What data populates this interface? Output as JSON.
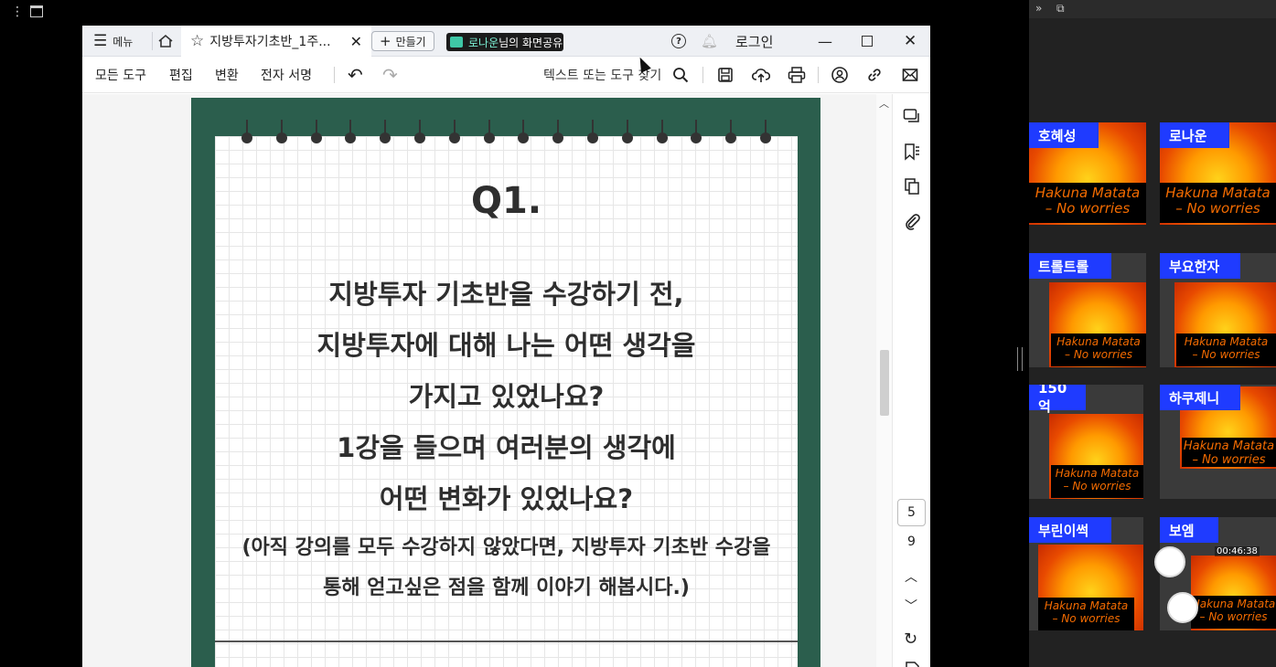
{
  "window": {
    "menu_label": "메뉴",
    "tab_title": "지방투자기초반_1주...",
    "new_tab_label": "만들기",
    "login_label": "로그인"
  },
  "share_banner": {
    "user": "로나운",
    "text": "님의 화면공유"
  },
  "toolbar": {
    "all_tools": "모든 도구",
    "edit": "편집",
    "convert": "변환",
    "esign": "전자 서명",
    "search_placeholder": "텍스트 또는 도구 찾기"
  },
  "document": {
    "heading": "Q1.",
    "lines": [
      "지방투자 기초반을 수강하기 전,",
      "지방투자에 대해 나는 어떤 생각을",
      "가지고 있었나요?",
      "1강을 들으며 여러분의 생각에",
      "어떤 변화가 있었나요?"
    ],
    "note_lines": [
      "(아직 강의를 모두 수강하지 않았다면, 지방투자 기초반 수강을",
      "통해 얻고싶은 점을 함께 이야기 해봅시다.)"
    ]
  },
  "pager": {
    "current": "5",
    "total": "9"
  },
  "video": {
    "caption_line1": "Hakuna Matata",
    "caption_line2": "– No worries",
    "timestamp": "00:46:38",
    "participants": [
      {
        "name": "호혜성"
      },
      {
        "name": "로나운"
      },
      {
        "name": "트롤트롤"
      },
      {
        "name": "부요한자"
      },
      {
        "name": "150억"
      },
      {
        "name": "하쿠제니"
      },
      {
        "name": "부린이썩"
      },
      {
        "name": "보엠"
      }
    ]
  },
  "colors": {
    "accent": "#1f3bff",
    "frame_green": "#2b5e4d",
    "caption": "#f36b00"
  }
}
